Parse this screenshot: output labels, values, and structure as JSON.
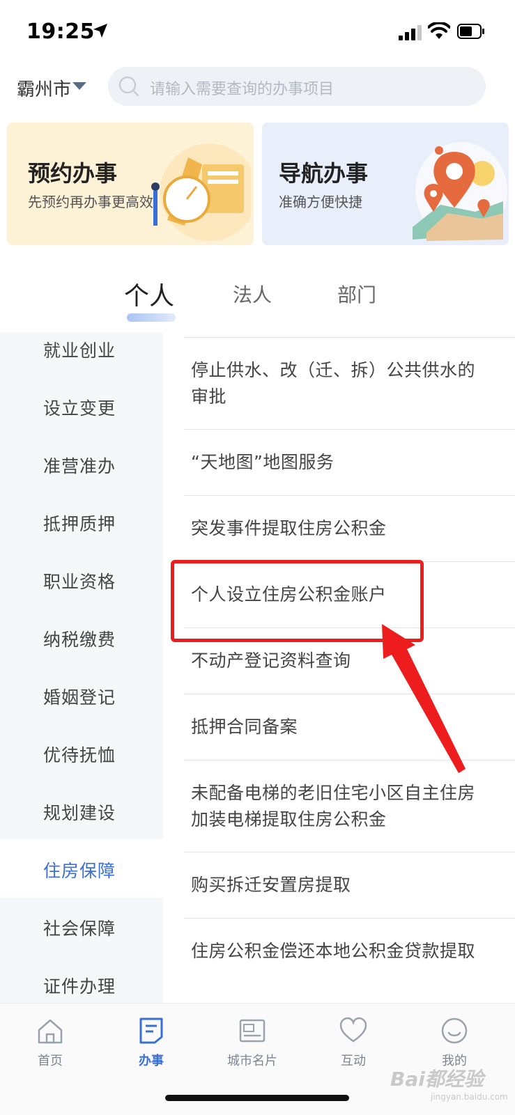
{
  "status": {
    "time": "19:25"
  },
  "header": {
    "city": "霸州市",
    "search_placeholder": "请输入需要查询的办事项目"
  },
  "cards": [
    {
      "title": "预约办事",
      "subtitle": "先预约再办事更高效"
    },
    {
      "title": "导航办事",
      "subtitle": "准确方便快捷"
    }
  ],
  "tabs": [
    {
      "label": "个人",
      "active": true
    },
    {
      "label": "法人",
      "active": false
    },
    {
      "label": "部门",
      "active": false
    }
  ],
  "sidebar": {
    "items": [
      {
        "label": "就业创业"
      },
      {
        "label": "设立变更"
      },
      {
        "label": "准营准办"
      },
      {
        "label": "抵押质押"
      },
      {
        "label": "职业资格"
      },
      {
        "label": "纳税缴费"
      },
      {
        "label": "婚姻登记"
      },
      {
        "label": "优待抚恤"
      },
      {
        "label": "规划建设"
      },
      {
        "label": "住房保障",
        "active": true
      },
      {
        "label": "社会保障"
      },
      {
        "label": "证件办理"
      }
    ]
  },
  "list": {
    "items": [
      {
        "label": "停止供水、改（迁、拆）公共供水的审批"
      },
      {
        "label": "“天地图”地图服务"
      },
      {
        "label": "突发事件提取住房公积金"
      },
      {
        "label": "个人设立住房公积金账户",
        "highlighted": true
      },
      {
        "label": "不动产登记资料查询"
      },
      {
        "label": "抵押合同备案"
      },
      {
        "label": "未配备电梯的老旧住宅小区自主住房加装电梯提取住房公积金"
      },
      {
        "label": "购买拆迁安置房提取"
      },
      {
        "label": "住房公积金偿还本地公积金贷款提取"
      }
    ]
  },
  "tabbar": {
    "items": [
      {
        "label": "首页",
        "icon": "home-icon"
      },
      {
        "label": "办事",
        "icon": "document-icon",
        "active": true
      },
      {
        "label": "城市名片",
        "icon": "city-card-icon"
      },
      {
        "label": "互动",
        "icon": "heart-icon"
      },
      {
        "label": "我的",
        "icon": "profile-icon"
      }
    ]
  },
  "watermark": {
    "text": "Bai都经验",
    "sub": "jingyan.baidu.com"
  },
  "colors": {
    "accent": "#3b6fd8",
    "highlight": "#ee1d1d"
  }
}
